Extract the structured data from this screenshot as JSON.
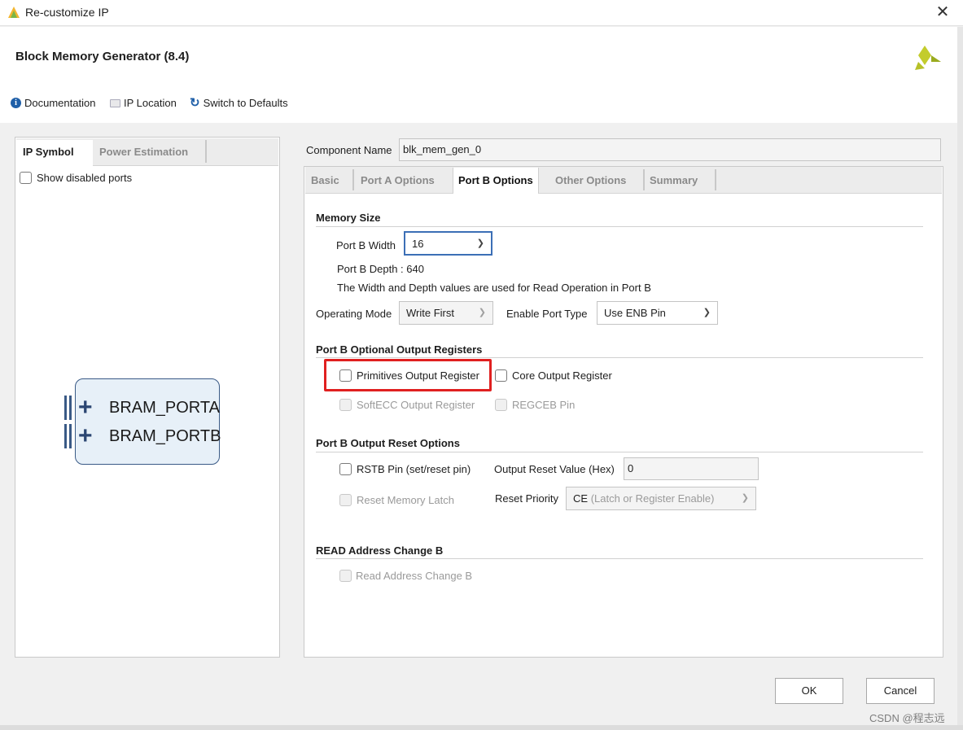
{
  "window": {
    "title": "Re-customize IP",
    "close_glyph": "✕"
  },
  "header": {
    "title": "Block Memory Generator (8.4)"
  },
  "toolbar": {
    "documentation": "Documentation",
    "ip_location": "IP Location",
    "switch_defaults": "Switch to Defaults"
  },
  "left_panel": {
    "tabs": [
      "IP Symbol",
      "Power Estimation"
    ],
    "show_disabled_ports": "Show disabled ports",
    "ports": [
      "BRAM_PORTA",
      "BRAM_PORTB"
    ]
  },
  "component": {
    "label": "Component Name",
    "value": "blk_mem_gen_0"
  },
  "tabs": [
    "Basic",
    "Port A Options",
    "Port B Options",
    "Other Options",
    "Summary"
  ],
  "memory_size": {
    "title": "Memory Size",
    "width_label": "Port B Width",
    "width_value": "16",
    "depth_text": "Port B Depth : 640",
    "note": "The Width and Depth values are used for Read Operation in Port B",
    "operating_mode_label": "Operating Mode",
    "operating_mode_value": "Write First",
    "enable_port_type_label": "Enable Port Type",
    "enable_port_type_value": "Use ENB Pin"
  },
  "optional_output_registers": {
    "title": "Port B Optional Output Registers",
    "primitives": "Primitives Output Register",
    "core": "Core Output Register",
    "softecc": "SoftECC Output Register",
    "regceb": "REGCEB Pin"
  },
  "output_reset": {
    "title": "Port B Output Reset Options",
    "rstb": "RSTB Pin (set/reset pin)",
    "reset_value_label": "Output Reset Value (Hex)",
    "reset_value": "0",
    "reset_memory_latch": "Reset Memory Latch",
    "reset_priority_label": "Reset Priority",
    "reset_priority_value": "CE",
    "reset_priority_detail": "(Latch or Register Enable)"
  },
  "read_address_change": {
    "title": "READ Address Change B",
    "option": "Read Address Change B"
  },
  "buttons": {
    "ok": "OK",
    "cancel": "Cancel"
  },
  "watermark": "CSDN @程志远",
  "colors": {
    "highlight": "#e02020",
    "accent": "#3c6fb6",
    "symbol_fill": "#e7f0f8"
  }
}
